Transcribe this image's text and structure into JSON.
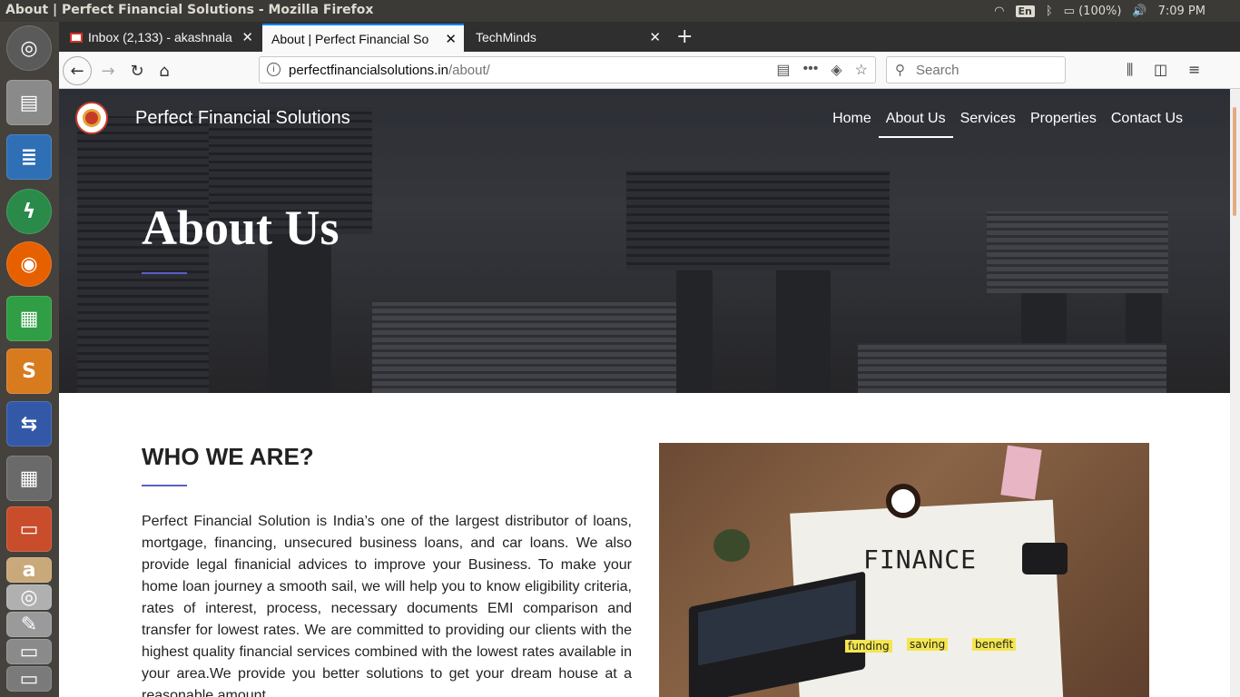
{
  "os": {
    "window_title": "About | Perfect Financial Solutions - Mozilla Firefox",
    "keyboard_layout": "En",
    "battery": "(100%)",
    "clock": "7:09 PM"
  },
  "browser": {
    "tabs": [
      {
        "label": "Inbox (2,133) - akashnala",
        "active": false
      },
      {
        "label": "About | Perfect Financial So",
        "active": true
      },
      {
        "label": "TechMinds",
        "active": false
      }
    ],
    "new_tab_label": "+",
    "url_domain": "perfectfinancialsolutions.in",
    "url_path": "/about/",
    "search_placeholder": "Search"
  },
  "site": {
    "brand_name": "Perfect Financial Solutions",
    "nav": [
      {
        "label": "Home",
        "active": false
      },
      {
        "label": "About Us",
        "active": true
      },
      {
        "label": "Services",
        "active": false
      },
      {
        "label": "Properties",
        "active": false
      },
      {
        "label": "Contact Us",
        "active": false
      }
    ],
    "hero_title": "About Us",
    "who_title": "WHO WE ARE?",
    "who_text": "Perfect Financial Solution is India’s one of the largest distributor of loans, mortgage, financing, unsecured business loans, and car loans. We also provide legal finanicial advices to improve your Business. To make your home loan journey a smooth sail, we will help you to know eligibility criteria, rates of interest, process, necessary documents EMI comparison and transfer for lowest rates. We are committed to providing our clients with the highest quality financial services combined with the lowest rates available in your area.We provide you better solutions to get your dream house at a reasonable amount.",
    "image": {
      "word": "FINANCE",
      "labels": [
        "funding",
        "saving",
        "benefit"
      ]
    }
  },
  "colors": {
    "accent_rule": "#5b5fc7",
    "tab_highlight": "#0a84ff"
  }
}
